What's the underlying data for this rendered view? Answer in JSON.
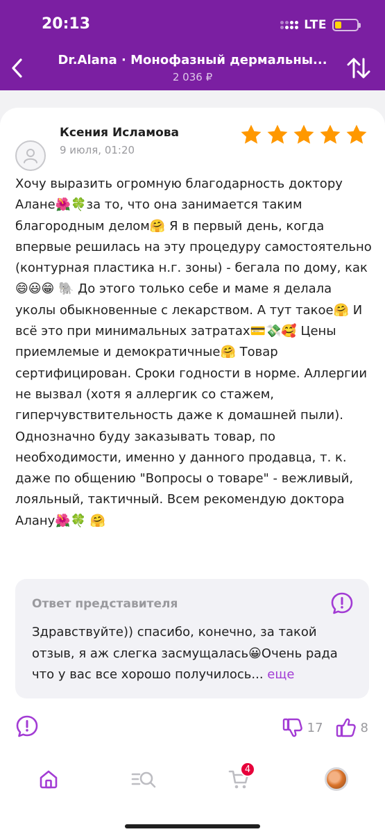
{
  "status_bar": {
    "time": "20:13",
    "network": "LTE"
  },
  "header": {
    "title": "Dr.Alana · Монофазный дермальны...",
    "price": "2 036 ₽",
    "back_icon": "chevron-left-icon",
    "sort_icon": "sort-arrows-icon"
  },
  "review": {
    "author": "Ксения Исламова",
    "date": "9 июля, 01:20",
    "rating": 5,
    "rating_max": 5,
    "text": "Хочу выразить огромную благодарность доктору Алане🌺🍀за то, что она занимается таким благородным делом🤗 Я в первый день, когда впервые решилась на эту процедуру самостоятельно (контурная пластика н.г. зоны) - бегала по дому, как 😄😃😁 🐘 До этого только себе и маме я делала уколы обыкновенные с лекарством. А тут такое🤗 И всё это при минимальных затратах💳💸🥰 Цены приемлемые и демократичные🤗 Товар сертифицирован. Сроки годности в норме. Аллергии не вызвал (хотя я аллергик со стажем, гиперчувствительность даже к домашней пыли). Однозначно буду заказывать товар, по необходимости, именно у данного продавца, т. к. даже по общению \"Вопросы о товаре\" - вежливый, лояльный, тактичный. Всем рекомендую доктора Алану🌺🍀 🤗"
  },
  "answer": {
    "title": "Ответ представителя",
    "text": "Здравствуйте)) спасибо, конечно, за такой отзыв, я аж слегка засмущалась😀Очень рада что у вас все хорошо получилось...",
    "more": "еще"
  },
  "votes": {
    "dislikes": "17",
    "likes": "8"
  },
  "bottom_nav": {
    "cart_badge": "4"
  },
  "colors": {
    "brand": "#7b1fa2",
    "star": "#ff9800",
    "accent": "#a23bd4",
    "badge": "#e6003a"
  }
}
